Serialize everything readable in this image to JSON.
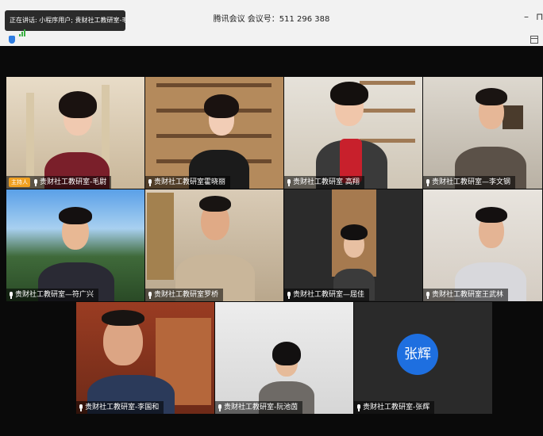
{
  "window": {
    "title": "腾讯会议 会议号：511 296 388",
    "speaking": "正在讲话: 小程序用户; 贵财社工教研室-毛尉",
    "minimize": "–",
    "restore": "⊓"
  },
  "host_tag": "主持人",
  "participants": [
    {
      "name": "贵财社工教研室-毛尉",
      "host": true
    },
    {
      "name": "贵财社工教研室霍晓丽"
    },
    {
      "name": "贵财社工教研室 高翔"
    },
    {
      "name": "贵财社工教研室—李文钢"
    },
    {
      "name": "贵财社工教研室—符广兴"
    },
    {
      "name": "贵财社工教研室罗桥"
    },
    {
      "name": "贵财社工教研室—屈佳"
    },
    {
      "name": "贵财社工教研室王武林"
    },
    {
      "name": "贵财社工教研室-李国和"
    },
    {
      "name": "贵财社工教研室-阮池茵"
    },
    {
      "name": "贵财社工教研室-张辉",
      "avatar_text": "张辉",
      "avatar_color": "#1e6fe0"
    }
  ]
}
